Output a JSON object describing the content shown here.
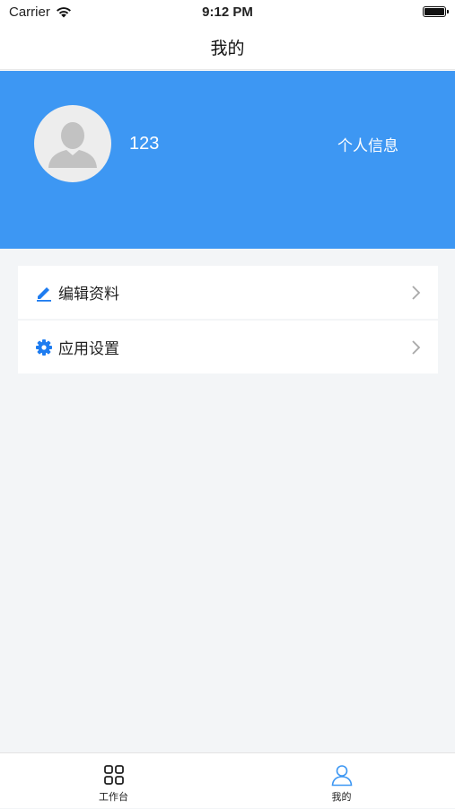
{
  "status_bar": {
    "carrier": "Carrier",
    "time": "9:12 PM"
  },
  "nav": {
    "title": "我的"
  },
  "profile": {
    "username": "123",
    "info_link": "个人信息",
    "header_color": "#3d97f3"
  },
  "menu": [
    {
      "label": "编辑资料",
      "icon": "edit-pencil-icon"
    },
    {
      "label": "应用设置",
      "icon": "gear-icon"
    }
  ],
  "tabs": [
    {
      "label": "工作台",
      "icon": "grid-icon",
      "active": false
    },
    {
      "label": "我的",
      "icon": "person-icon",
      "active": true
    }
  ],
  "colors": {
    "accent": "#3d97f3",
    "icon_blue": "#1e7cf0",
    "active_tab": "#3d97f3"
  }
}
